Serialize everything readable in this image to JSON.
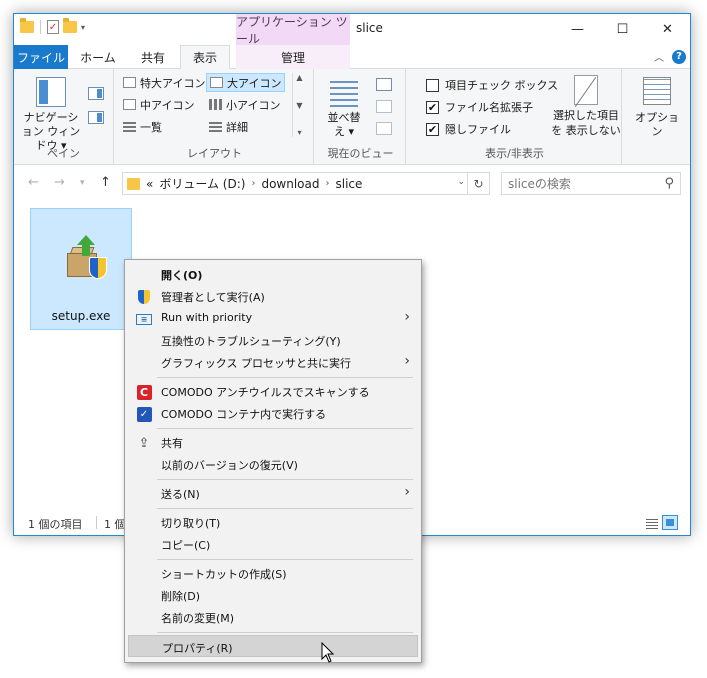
{
  "window": {
    "title": "slice",
    "context_tab_title": "アプリケーション ツール",
    "buttons": {
      "minimize": "—",
      "maximize": "☐",
      "close": "✕"
    }
  },
  "tabs": {
    "file": "ファイル",
    "home": "ホーム",
    "share": "共有",
    "view": "表示",
    "manage": "管理"
  },
  "ribbon": {
    "pane": {
      "nav_pane_label": "ナビゲーション ウィンドウ ▾",
      "group_label": "ペイン"
    },
    "layout": {
      "items": [
        "特大アイコン",
        "大アイコン",
        "中アイコン",
        "小アイコン",
        "一覧",
        "詳細"
      ],
      "selected": "大アイコン",
      "group_label": "レイアウト"
    },
    "current_view": {
      "sort_label": "並べ替え ▾",
      "group_label": "現在のビュー"
    },
    "show_hide": {
      "checkboxes": [
        {
          "label": "項目チェック ボックス",
          "checked": false
        },
        {
          "label": "ファイル名拡張子",
          "checked": true
        },
        {
          "label": "隠しファイル",
          "checked": true
        }
      ],
      "hide_selected_label": "選択した項目を 表示しない",
      "group_label": "表示/非表示"
    },
    "options": {
      "label": "オプション"
    }
  },
  "address": {
    "prefix": "«",
    "segments": [
      "ボリューム (D:)",
      "download",
      "slice"
    ],
    "search_placeholder": "sliceの検索"
  },
  "files": [
    {
      "name": "setup.exe"
    }
  ],
  "status": {
    "count": "1 個の項目",
    "selected": "1 個"
  },
  "context_menu": {
    "items": [
      {
        "label": "開く(O)",
        "icon": "none",
        "bold": true
      },
      {
        "label": "管理者として実行(A)",
        "icon": "uac-shield-icon"
      },
      {
        "label": "Run with priority",
        "icon": "run-with-priority-icon",
        "submenu": true
      },
      {
        "label": "互換性のトラブルシューティング(Y)",
        "icon": "none"
      },
      {
        "label": "グラフィックス プロセッサと共に実行",
        "icon": "none",
        "submenu": true
      },
      {
        "label": "COMODO アンチウイルスでスキャンする",
        "icon": "comodo-antivirus-icon"
      },
      {
        "label": "COMODO コンテナ内で実行する",
        "icon": "comodo-container-icon"
      },
      {
        "label": "共有",
        "icon": "share-icon"
      },
      {
        "label": "以前のバージョンの復元(V)",
        "icon": "none"
      },
      {
        "label": "送る(N)",
        "icon": "none",
        "submenu": true
      },
      {
        "label": "切り取り(T)",
        "icon": "none"
      },
      {
        "label": "コピー(C)",
        "icon": "none"
      },
      {
        "label": "ショートカットの作成(S)",
        "icon": "none"
      },
      {
        "label": "削除(D)",
        "icon": "none"
      },
      {
        "label": "名前の変更(M)",
        "icon": "none"
      },
      {
        "label": "プロパティ(R)",
        "icon": "none",
        "hovered": true
      }
    ]
  },
  "colors": {
    "accent": "#1979ca",
    "selection": "#cce8ff",
    "context_tab": "#f2d9f6"
  }
}
